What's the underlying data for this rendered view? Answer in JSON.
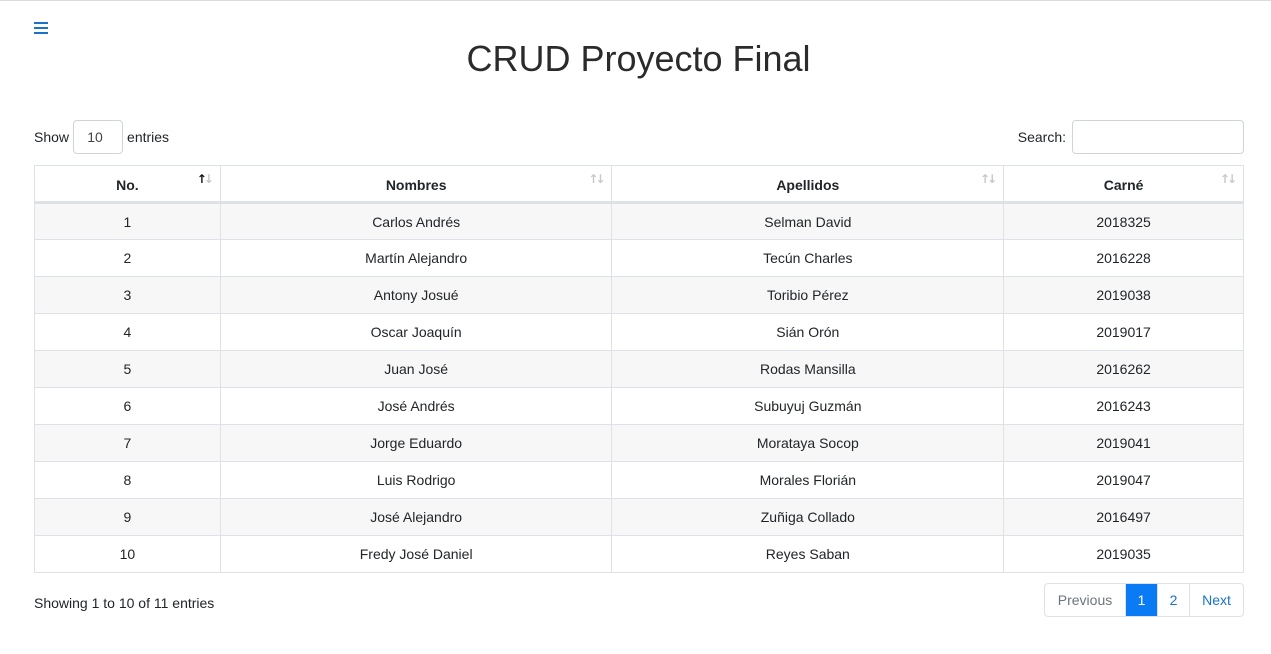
{
  "page": {
    "title": "CRUD Proyecto Final"
  },
  "menu": {
    "icon": "hamburger-icon"
  },
  "length": {
    "show_label": "Show",
    "value": "10",
    "entries_label": "entries"
  },
  "search": {
    "label": "Search:",
    "placeholder": ""
  },
  "table": {
    "headers": [
      "No.",
      "Nombres",
      "Apellidos",
      "Carné"
    ],
    "sort_icon": "sort-arrows-icon",
    "rows": [
      [
        "1",
        "Carlos Andrés",
        "Selman David",
        "2018325"
      ],
      [
        "2",
        "Martín Alejandro",
        "Tecún Charles",
        "2016228"
      ],
      [
        "3",
        "Antony Josué",
        "Toribio Pérez",
        "2019038"
      ],
      [
        "4",
        "Oscar Joaquín",
        "Sián Orón",
        "2019017"
      ],
      [
        "5",
        "Juan José",
        "Rodas Mansilla",
        "2016262"
      ],
      [
        "6",
        "José Andrés",
        "Subuyuj Guzmán",
        "2016243"
      ],
      [
        "7",
        "Jorge Eduardo",
        "Morataya Socop",
        "2019041"
      ],
      [
        "8",
        "Luis Rodrigo",
        "Morales Florián",
        "2019047"
      ],
      [
        "9",
        "José Alejandro",
        "Zuñiga Collado",
        "2016497"
      ],
      [
        "10",
        "Fredy José Daniel",
        "Reyes Saban",
        "2019035"
      ]
    ]
  },
  "info": {
    "text": "Showing 1 to 10 of 11 entries"
  },
  "pagination": {
    "previous": "Previous",
    "pages": [
      "1",
      "2"
    ],
    "next": "Next",
    "current": "1"
  },
  "colors": {
    "accent": "#0a7bf5",
    "link": "#1a73c7",
    "stripe": "#f7f7f7"
  }
}
